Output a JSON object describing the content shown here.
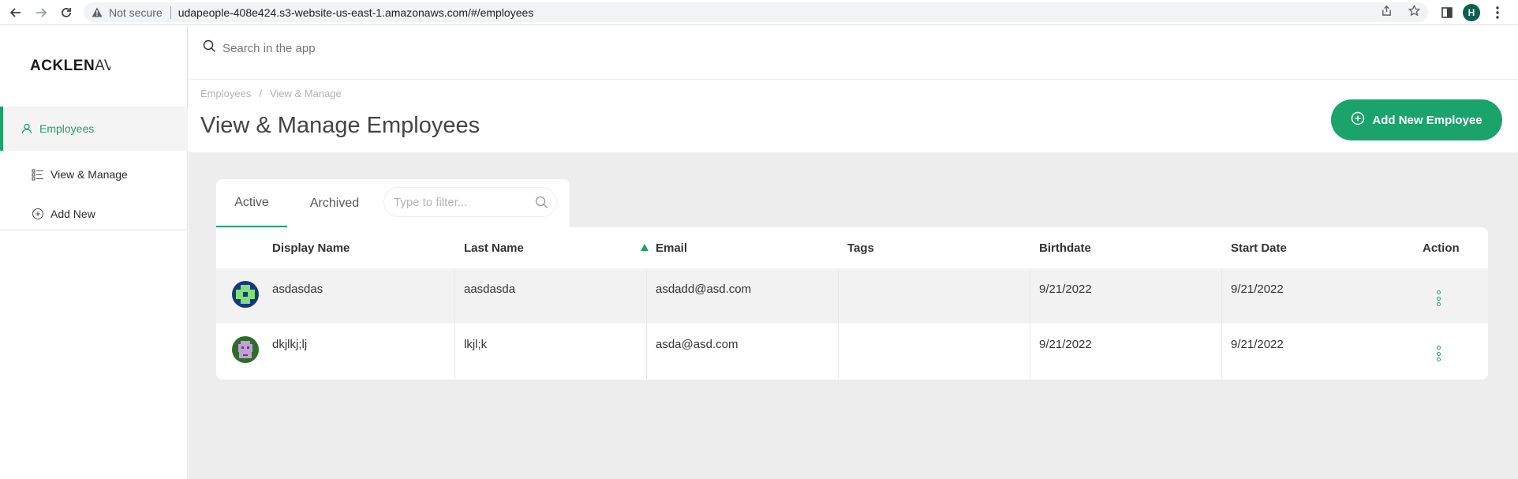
{
  "browser": {
    "security_label": "Not secure",
    "url": "udapeople-408e424.s3-website-us-east-1.amazonaws.com/#/employees",
    "profile_initial": "H"
  },
  "sidebar": {
    "logo": "ACKLEN",
    "logo_partial": "AV",
    "items": [
      {
        "label": "Employees",
        "icon": "user-icon",
        "active": true
      },
      {
        "label": "View & Manage",
        "icon": "list-icon",
        "active": false
      },
      {
        "label": "Add New",
        "icon": "plus-circle-icon",
        "active": false
      }
    ]
  },
  "search": {
    "placeholder": "Search in the app"
  },
  "breadcrumb": [
    "Employees",
    "/",
    "View & Manage"
  ],
  "page_title": "View & Manage Employees",
  "add_button_label": "Add New Employee",
  "tabs": [
    {
      "label": "Active",
      "active": true
    },
    {
      "label": "Archived",
      "active": false
    }
  ],
  "filter": {
    "placeholder": "Type to filter..."
  },
  "table": {
    "columns": [
      "Display Name",
      "Last Name",
      "Email",
      "Tags",
      "Birthdate",
      "Start Date",
      "Action"
    ],
    "sorted_column": "Email",
    "sort_direction": "asc",
    "rows": [
      {
        "display_name": "asdasdas",
        "last_name": "aasdasda",
        "email": "asdadd@asd.com",
        "tags": "",
        "birthdate": "9/21/2022",
        "start_date": "9/21/2022",
        "avatar_colors": [
          "#18377a",
          "#7fe07a"
        ]
      },
      {
        "display_name": "dkjlkj;lj",
        "last_name": "lkjl;k",
        "email": "asda@asd.com",
        "tags": "",
        "birthdate": "9/21/2022",
        "start_date": "9/21/2022",
        "avatar_colors": [
          "#2f6b2a",
          "#c89be0"
        ]
      }
    ]
  },
  "colors": {
    "accent": "#1aa36b",
    "content_bg": "#ecedec"
  }
}
